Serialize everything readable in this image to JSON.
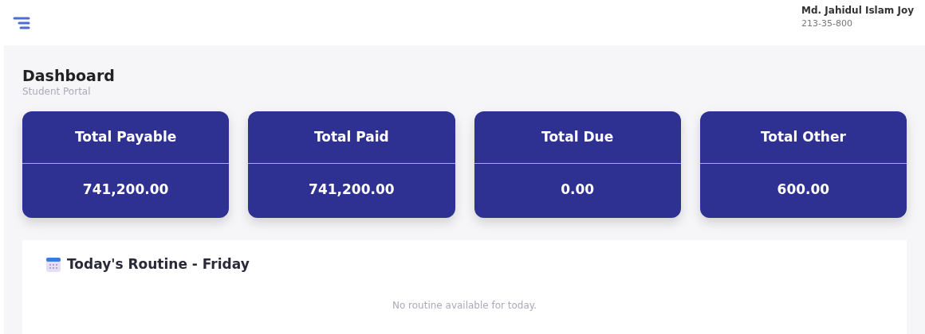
{
  "user": {
    "name": "Md. Jahidul Islam Joy",
    "id": "213-35-800"
  },
  "page": {
    "title": "Dashboard",
    "subtitle": "Student Portal"
  },
  "stats": [
    {
      "label": "Total Payable",
      "value": "741,200.00"
    },
    {
      "label": "Total Paid",
      "value": "741,200.00"
    },
    {
      "label": "Total Due",
      "value": "0.00"
    },
    {
      "label": "Total Other",
      "value": "600.00"
    }
  ],
  "routine": {
    "title": "Today's Routine - Friday",
    "empty_message": "No routine available for today."
  }
}
